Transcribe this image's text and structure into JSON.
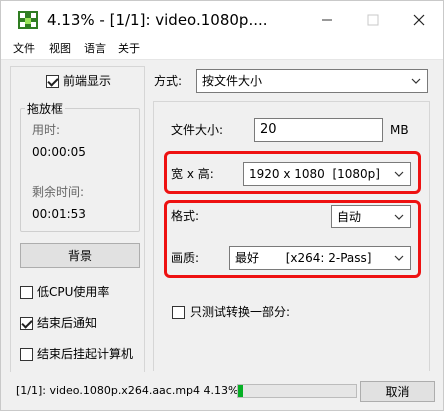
{
  "window": {
    "title": "4.13% - [1/1]: video.1080p....",
    "accent_color": "#ee1111"
  },
  "menu": {
    "items": [
      "文件",
      "视图",
      "语言",
      "关于"
    ]
  },
  "left_panel": {
    "front_display_label": "前端显示",
    "front_display_checked": true,
    "drop_box_title": "拖放框",
    "used_time_label": "用时:",
    "used_time_value": "00:00:05",
    "remaining_label": "剩余时间:",
    "remaining_value": "00:01:53",
    "background_button": "背景",
    "low_cpu_label": "低CPU使用率",
    "low_cpu_checked": false,
    "notify_label": "结束后通知",
    "notify_checked": true,
    "shutdown_label": "结束后挂起计算机",
    "shutdown_checked": false
  },
  "right_panel": {
    "mode_label": "方式:",
    "mode_value": "按文件大小",
    "file_size_label": "文件大小:",
    "file_size_value": "20",
    "file_size_unit": "MB",
    "resolution_label": "宽 x 高:",
    "resolution_value": "1920 x 1080  [1080p]",
    "format_label": "格式:",
    "format_value": "自动",
    "quality_label": "画质:",
    "quality_value": "最好       [x264: 2-Pass]",
    "test_partial_label": "只测试转换一部分:",
    "test_partial_checked": false
  },
  "status": {
    "text": "[1/1]: video.1080p.x264.aac.mp4  4.13%",
    "progress_percent": 4.13,
    "cancel_button": "取消"
  }
}
